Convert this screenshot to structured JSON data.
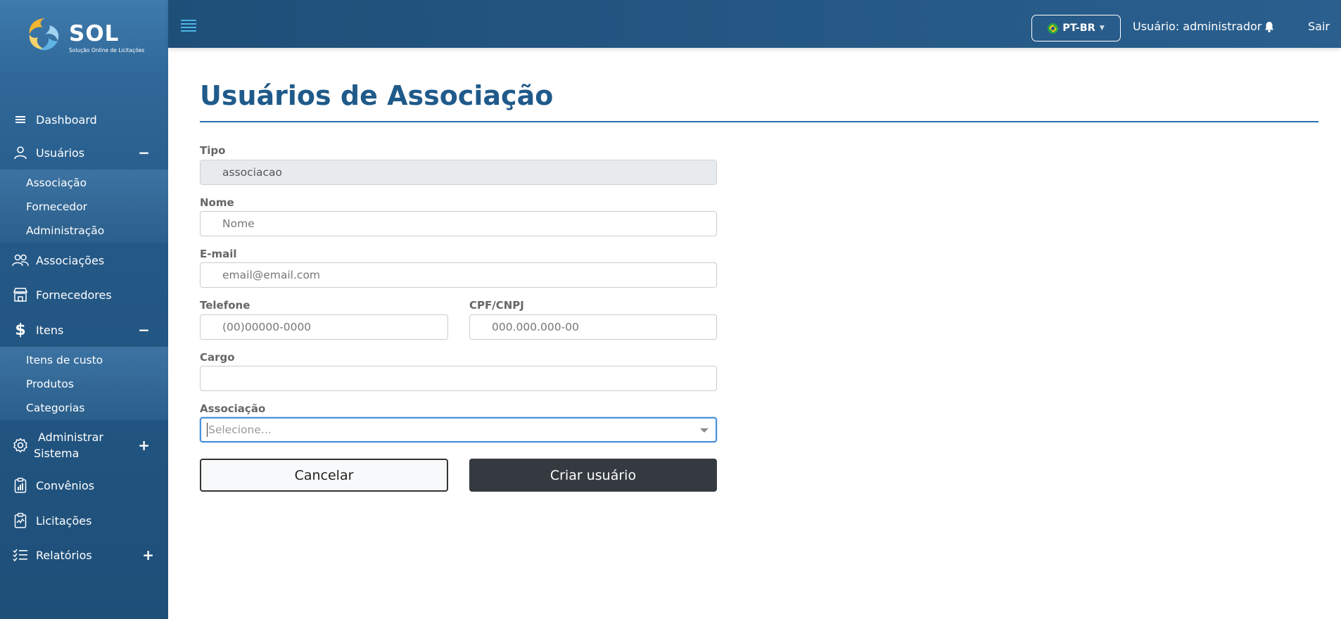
{
  "brand": {
    "name": "SOL",
    "tagline": "Solução Online de Licitações"
  },
  "sidebar": {
    "items": [
      {
        "label": "Dashboard",
        "icon": "bars-icon"
      },
      {
        "label": "Usuários",
        "icon": "user-icon",
        "toggle": "−",
        "children": [
          "Associação",
          "Fornecedor",
          "Administração"
        ]
      },
      {
        "label": "Associações",
        "icon": "users-icon"
      },
      {
        "label": "Fornecedores",
        "icon": "store-icon"
      },
      {
        "label": "Itens",
        "icon": "dollar-icon",
        "toggle": "−",
        "children": [
          "Itens de custo",
          "Produtos",
          "Categorias"
        ]
      },
      {
        "label_line1": "Administrar",
        "label_line2": "Sistema",
        "icon": "gear-icon",
        "toggle": "+"
      },
      {
        "label": "Convênios",
        "icon": "clipboard-chart-icon"
      },
      {
        "label": "Licitações",
        "icon": "clipboard-check-icon"
      },
      {
        "label": "Relatórios",
        "icon": "list-check-icon",
        "toggle": "+"
      }
    ]
  },
  "topbar": {
    "language": "PT-BR",
    "user_label": "Usuário: administrador",
    "logout_label": "Sair"
  },
  "page": {
    "title": "Usuários de Associação"
  },
  "form": {
    "tipo": {
      "label": "Tipo",
      "value": "associacao"
    },
    "nome": {
      "label": "Nome",
      "placeholder": "Nome"
    },
    "email": {
      "label": "E-mail",
      "placeholder": "email@email.com"
    },
    "telefone": {
      "label": "Telefone",
      "placeholder": "(00)00000-0000"
    },
    "cpf": {
      "label": "CPF/CNPJ",
      "placeholder": "000.000.000-00"
    },
    "cargo": {
      "label": "Cargo",
      "placeholder": ""
    },
    "associacao": {
      "label": "Associação",
      "placeholder": "Selecione..."
    },
    "cancel_label": "Cancelar",
    "submit_label": "Criar usuário"
  },
  "colors": {
    "sidebar": "#245886",
    "topbar": "#1e4f79",
    "title": "#1f5a8a",
    "button_dark": "#343a40"
  }
}
